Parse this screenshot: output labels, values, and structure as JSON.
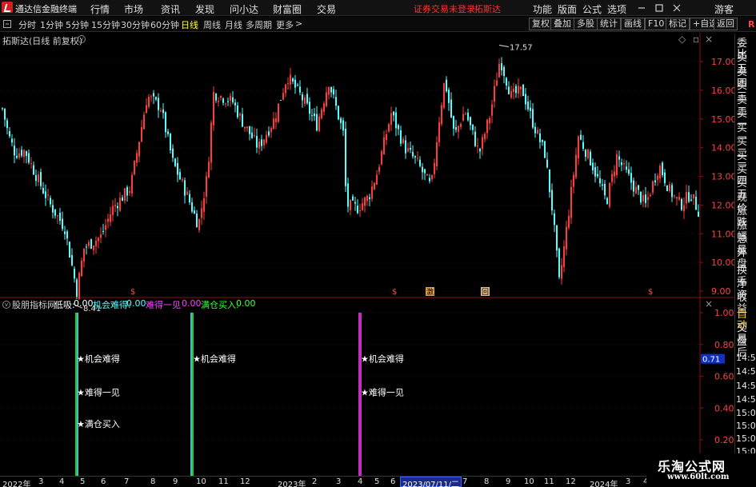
{
  "app": {
    "title": "通达信金融终端"
  },
  "menu": [
    "行情",
    "市场",
    "资讯",
    "发现",
    "问小达",
    "财富圈",
    "交易"
  ],
  "warning": "证券交易未登录",
  "stock_name_top": "拓斯达",
  "right_menu": [
    "功能",
    "版面",
    "公式",
    "选项"
  ],
  "guest": "游客",
  "toolbar": {
    "periods": [
      "分时",
      "1分钟",
      "5分钟",
      "15分钟",
      "30分钟",
      "60分钟",
      "日线",
      "周线",
      "月线",
      "多周期",
      "更多"
    ],
    "active": "日线",
    "more_arrow": ">",
    "right_buttons": [
      "复权",
      "叠加",
      "多股",
      "统计",
      "画线",
      "F10",
      "标记",
      "+自选",
      "返回"
    ],
    "r_badge": "R"
  },
  "main_chart": {
    "title": "拓斯达(日线 前复权)",
    "high_label": "17.57",
    "low_label": "8.41",
    "y_ticks": [
      "17.00",
      "16.00",
      "15.00",
      "14.00",
      "13.00",
      "12.00",
      "11.00",
      "10.00",
      "9.00"
    ],
    "markers": [
      "$",
      "$",
      "$",
      "$"
    ],
    "mark_boxes": [
      "激",
      "回"
    ],
    "colors": {
      "up": "#ff3c3c",
      "down": "#54ffff"
    }
  },
  "indicator": {
    "name": "股朋指标网",
    "values": [
      {
        "label": "低吸:",
        "value": "0.00",
        "color": "#ffffff"
      },
      {
        "label": "机会难得:",
        "value": "0.00",
        "color": "#54ffff"
      },
      {
        "label": "难得一见",
        "value": "0.00",
        "color": "#ff40ff"
      },
      {
        "label": "满仓买入:",
        "value": "0.00",
        "color": "#40ff40"
      }
    ],
    "y_ticks": [
      "1.00",
      "0.80",
      "0.60",
      "0.40",
      "0.20"
    ],
    "cursor_value": "0.71",
    "annotations": [
      {
        "text": "★机会难得"
      },
      {
        "text": "★难得一见"
      },
      {
        "text": "★满仓买入"
      },
      {
        "text": "★机会难得"
      },
      {
        "text": "★机会难得"
      },
      {
        "text": "★难得一见"
      }
    ]
  },
  "sidebar": {
    "items": [
      "委比",
      "卖五",
      "卖四",
      "卖三",
      "卖二",
      "卖一",
      "买一",
      "买二",
      "买三",
      "买四",
      "买五",
      "现价",
      "涨跌",
      "涨幅",
      "总量",
      "外盘",
      "换手",
      "净资",
      "收益",
      "自动",
      "交易",
      "盘后"
    ],
    "active": "自动",
    "times": [
      "14:56",
      "14:56",
      "14:57",
      "14:58",
      "15:00",
      "15:00",
      "15:00",
      "15:00"
    ]
  },
  "time_axis": {
    "labels": [
      "2022年",
      "3",
      "4",
      "5",
      "6",
      "7",
      "8",
      "9",
      "10",
      "11",
      "12",
      "2023年",
      "2",
      "3",
      "4",
      "5",
      "6",
      "7",
      "8",
      "9",
      "10",
      "11",
      "12",
      "2024年",
      "3",
      "4",
      "5",
      "6",
      "7"
    ],
    "cursor": "2023/07/11/二"
  },
  "watermark": {
    "line1": "乐淘公式网",
    "line2": "www.60lt.com"
  }
}
